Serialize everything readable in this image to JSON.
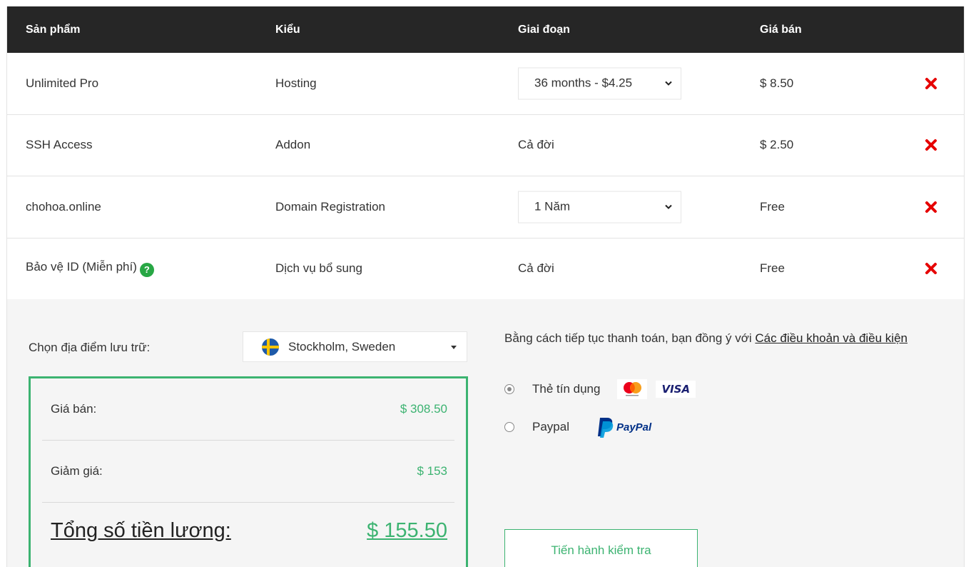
{
  "table": {
    "headers": [
      "Sản phẩm",
      "Kiểu",
      "Giai đoạn",
      "Giá bán"
    ],
    "rows": [
      {
        "product": "Unlimited Pro",
        "type": "Hosting",
        "period": "36 months - $4.25",
        "period_is_select": true,
        "price": "$ 8.50"
      },
      {
        "product": "SSH Access",
        "type": "Addon",
        "period": "Cả đời",
        "period_is_select": false,
        "price": "$ 2.50"
      },
      {
        "product": "chohoa.online",
        "type": "Domain Registration",
        "period": "1 Năm",
        "period_is_select": true,
        "price": "Free"
      },
      {
        "product": "Bảo vệ ID (Miễn phí)",
        "type": "Dịch vụ bổ sung",
        "period": "Cả đời",
        "period_is_select": false,
        "price": "Free",
        "help_icon": "question-circle-icon",
        "help_glyph": "?"
      }
    ],
    "remove_icon": "close-x-icon",
    "remove_color": "#e60000"
  },
  "location": {
    "label": "Chọn địa điểm lưu trữ:",
    "selected": "Stockholm, Sweden",
    "flag_icon": "sweden-flag-icon"
  },
  "summary": {
    "subtotal_label": "Giá bán:",
    "subtotal_value": "$ 308.50",
    "discount_label": "Giảm giá:",
    "discount_value": "$ 153",
    "total_label": "Tổng số tiền lương:",
    "total_value": "$ 155.50",
    "accent_color": "#3cb371"
  },
  "payment": {
    "terms_text": "Bằng cách tiếp tục thanh toán, bạn đồng ý với",
    "terms_link": "Các điều khoản và điều kiện",
    "methods": [
      {
        "label": "Thẻ tín dụng",
        "selected": true,
        "icons": [
          "mastercard-icon",
          "visa-icon"
        ],
        "visa_text": "VISA"
      },
      {
        "label": "Paypal",
        "selected": false,
        "icons": [
          "paypal-icon"
        ],
        "paypal_text": "PayPal"
      }
    ],
    "checkout_label": "Tiến hành kiểm tra"
  }
}
